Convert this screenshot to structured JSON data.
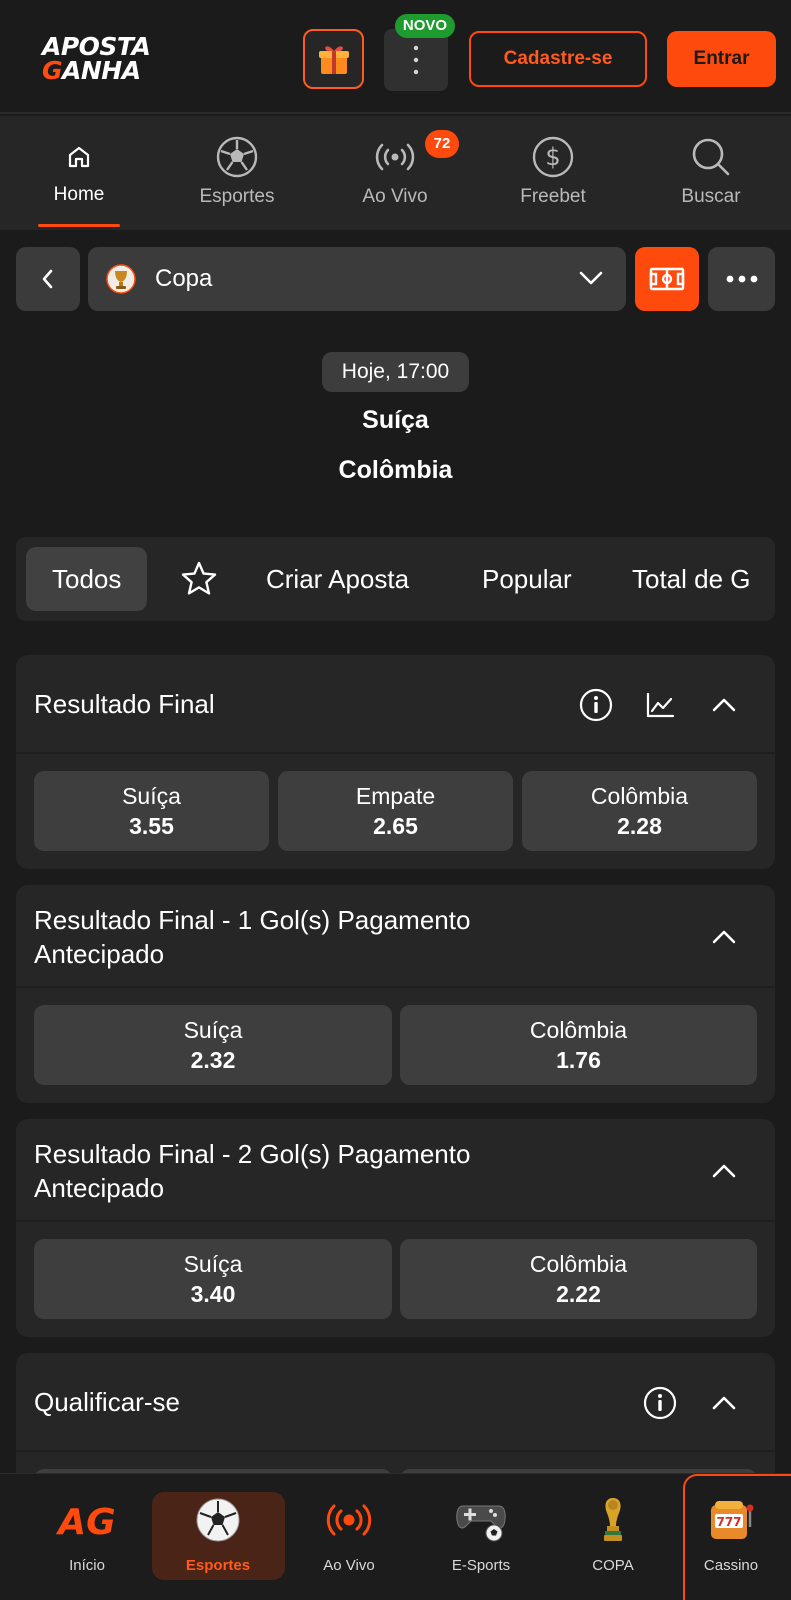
{
  "header": {
    "logo_line1": "APOSTA",
    "logo_line2_prefix": "G",
    "logo_line2_rest": "ANHA",
    "novo_badge": "NOVO",
    "signup_label": "Cadastre-se",
    "login_label": "Entrar"
  },
  "nav": {
    "items": [
      {
        "label": "Home",
        "icon": "home-icon",
        "active": true
      },
      {
        "label": "Esportes",
        "icon": "soccer-ball-icon"
      },
      {
        "label": "Ao Vivo",
        "icon": "live-broadcast-icon",
        "badge": "72"
      },
      {
        "label": "Freebet",
        "icon": "dollar-coin-icon"
      },
      {
        "label": "Buscar",
        "icon": "search-icon"
      }
    ]
  },
  "competition": {
    "name": "Copa"
  },
  "match": {
    "time": "Hoje, 17:00",
    "home": "Suíça",
    "away": "Colômbia"
  },
  "tabs": [
    "Todos",
    "Criar Aposta",
    "Popular",
    "Total de G"
  ],
  "markets": [
    {
      "title": "Resultado Final",
      "odds": [
        {
          "label": "Suíça",
          "price": "3.55"
        },
        {
          "label": "Empate",
          "price": "2.65"
        },
        {
          "label": "Colômbia",
          "price": "2.28"
        }
      ]
    },
    {
      "title_line1": "Resultado Final - 1 Gol(s) Pagamento",
      "title_line2": "Antecipado",
      "odds": [
        {
          "label": "Suíça",
          "price": "2.32"
        },
        {
          "label": "Colômbia",
          "price": "1.76"
        }
      ]
    },
    {
      "title_line1": "Resultado Final - 2 Gol(s) Pagamento",
      "title_line2": "Antecipado",
      "odds": [
        {
          "label": "Suíça",
          "price": "3.40"
        },
        {
          "label": "Colômbia",
          "price": "2.22"
        }
      ]
    },
    {
      "title": "Qualificar-se"
    }
  ],
  "bottom_nav": {
    "items": [
      {
        "label": "Início",
        "icon": "ag-logo-icon"
      },
      {
        "label": "Esportes",
        "icon": "soccer-ball-icon",
        "active": true
      },
      {
        "label": "Ao Vivo",
        "icon": "live-broadcast-icon"
      },
      {
        "label": "E-Sports",
        "icon": "gamepad-icon"
      },
      {
        "label": "COPA",
        "icon": "trophy-icon"
      },
      {
        "label": "Cassino",
        "icon": "slot-machine-icon"
      }
    ]
  },
  "colors": {
    "accent": "#ff4a0e",
    "background": "#1b1b1b",
    "card": "#262626",
    "odd_button": "#3e3e3e",
    "novo_green": "#1f9a2f"
  }
}
